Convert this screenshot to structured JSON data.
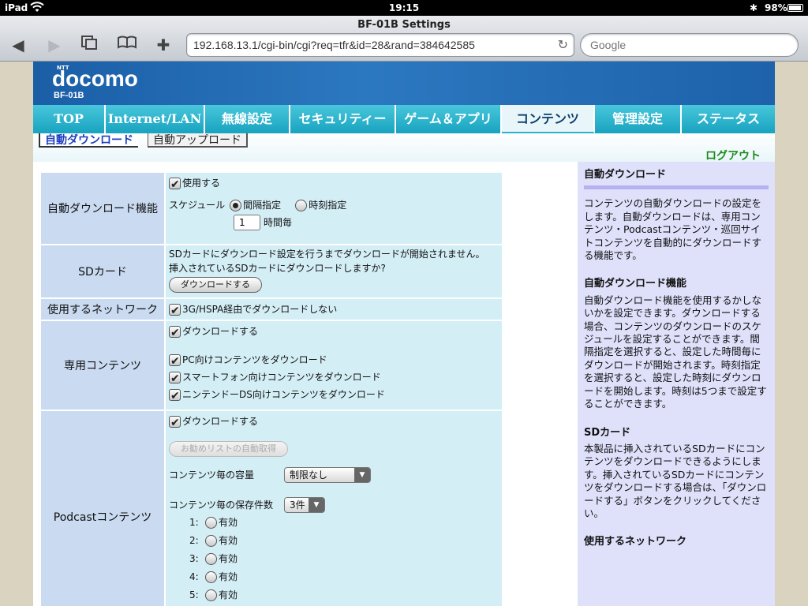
{
  "status_bar": {
    "device": "iPad",
    "time": "19:15",
    "battery": "98%"
  },
  "browser": {
    "page_title": "BF-01B Settings",
    "url": "192.168.13.1/cgi-bin/cgi?req=tfr&id=28&rand=384642585",
    "search_placeholder": "Google"
  },
  "header": {
    "brand_small": "NTT",
    "brand": "docomo",
    "model": "BF-01B"
  },
  "menu": [
    {
      "label": "TOP"
    },
    {
      "label": "Internet/LAN"
    },
    {
      "label": "無線設定"
    },
    {
      "label": "セキュリティー"
    },
    {
      "label": "ゲーム＆アプリ"
    },
    {
      "label": "コンテンツ"
    },
    {
      "label": "管理設定"
    },
    {
      "label": "ステータス"
    }
  ],
  "subnav": {
    "active": "自動ダウンロード",
    "inactive": "自動アップロード",
    "logout": "ログアウト"
  },
  "settings": {
    "auto_download": {
      "label": "自動ダウンロード機能",
      "use_label": "使用する",
      "schedule_label": "スケジュール",
      "interval_label": "間隔指定",
      "time_label": "時刻指定",
      "hours_value": "1",
      "hours_suffix": "時間毎"
    },
    "sd_card": {
      "label": "SDカード",
      "line1": "SDカードにダウンロード設定を行うまでダウンロードが開始されません。",
      "line2": "挿入されているSDカードにダウンロードしますか?",
      "button": "ダウンロードする"
    },
    "network": {
      "label": "使用するネットワーク",
      "option": "3G/HSPA経由でダウンロードしない"
    },
    "dedicated": {
      "label": "専用コンテンツ",
      "download": "ダウンロードする",
      "pc": "PC向けコンテンツをダウンロード",
      "smartphone": "スマートフォン向けコンテンツをダウンロード",
      "ds": "ニンテンドーDS向けコンテンツをダウンロード"
    },
    "podcast": {
      "label": "Podcastコンテンツ",
      "download": "ダウンロードする",
      "auto_fetch": "お勧めリストの自動取得",
      "capacity_label": "コンテンツ毎の容量",
      "capacity_value": "制限なし",
      "count_label": "コンテンツ毎の保存件数",
      "count_value": "3件",
      "enable_label": "有効",
      "rows": [
        "1:",
        "2:",
        "3:",
        "4:",
        "5:"
      ]
    }
  },
  "help": [
    {
      "title": "自動ダウンロード",
      "text": "コンテンツの自動ダウンロードの設定をします。自動ダウンロードは、専用コンテンツ・Podcastコンテンツ・巡回サイトコンテンツを自動的にダウンロードする機能です。"
    },
    {
      "title": "自動ダウンロード機能",
      "text": "自動ダウンロード機能を使用するかしないかを設定できます。ダウンロードする場合、コンテンツのダウンロードのスケジュールを設定することができます。間隔指定を選択すると、設定した時間毎にダウンロードが開始されます。時刻指定を選択すると、設定した時刻にダウンロードを開始します。時刻は5つまで設定することができます。"
    },
    {
      "title": "SDカード",
      "text": "本製品に挿入されているSDカードにコンテンツをダウンロードできるようにします。挿入されているSDカードにコンテンツをダウンロードする場合は、「ダウンロードする」ボタンをクリックしてください。"
    },
    {
      "title": "使用するネットワーク",
      "text": ""
    }
  ]
}
